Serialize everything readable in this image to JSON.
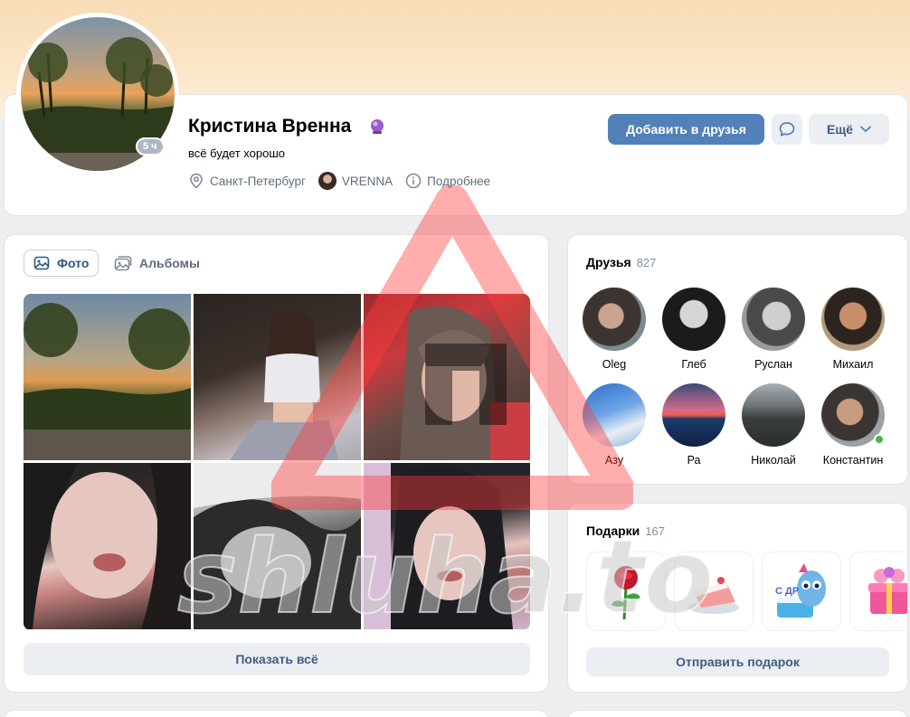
{
  "profile": {
    "name": "Кристина Вренна",
    "status": "всё будет хорошо",
    "last_seen": "5 ч",
    "city": "Санкт-Петербург",
    "linked_account": "VRENNA",
    "details_link": "Подробнее",
    "name_badge_icon": "crystal-ball-icon"
  },
  "actions": {
    "add_friend": "Добавить в друзья",
    "message_icon": "message-bubble-icon",
    "more": "Ещё"
  },
  "photos": {
    "tabs": [
      {
        "label": "Фото",
        "icon": "image-icon",
        "active": true
      },
      {
        "label": "Альбомы",
        "icon": "albums-icon",
        "active": false
      }
    ],
    "count_shown": 6,
    "show_all": "Показать всё"
  },
  "friends": {
    "title": "Друзья",
    "count": "827",
    "items": [
      {
        "name": "Oleg",
        "online": false
      },
      {
        "name": "Глеб",
        "online": false
      },
      {
        "name": "Руслан",
        "online": false
      },
      {
        "name": "Михаил",
        "online": false
      },
      {
        "name": "Азу",
        "online": false
      },
      {
        "name": "Ра",
        "online": false
      },
      {
        "name": "Николай",
        "online": false
      },
      {
        "name": "Константин",
        "online": true
      }
    ]
  },
  "gifts": {
    "title": "Подарки",
    "count": "167",
    "items": [
      "rose-gift",
      "cake-gift",
      "birthday-creature-gift",
      "gift-box-gift"
    ],
    "send_gift": "Отправить подарок"
  },
  "watermark": {
    "text": "shluha.to"
  },
  "colors": {
    "accent": "#5181b8",
    "link": "#2a5885",
    "secondary_button_bg": "#ebeef3",
    "page_bg": "#edeef0",
    "online_green": "#4bb34b",
    "watermark_red": "#ff3b3b"
  }
}
